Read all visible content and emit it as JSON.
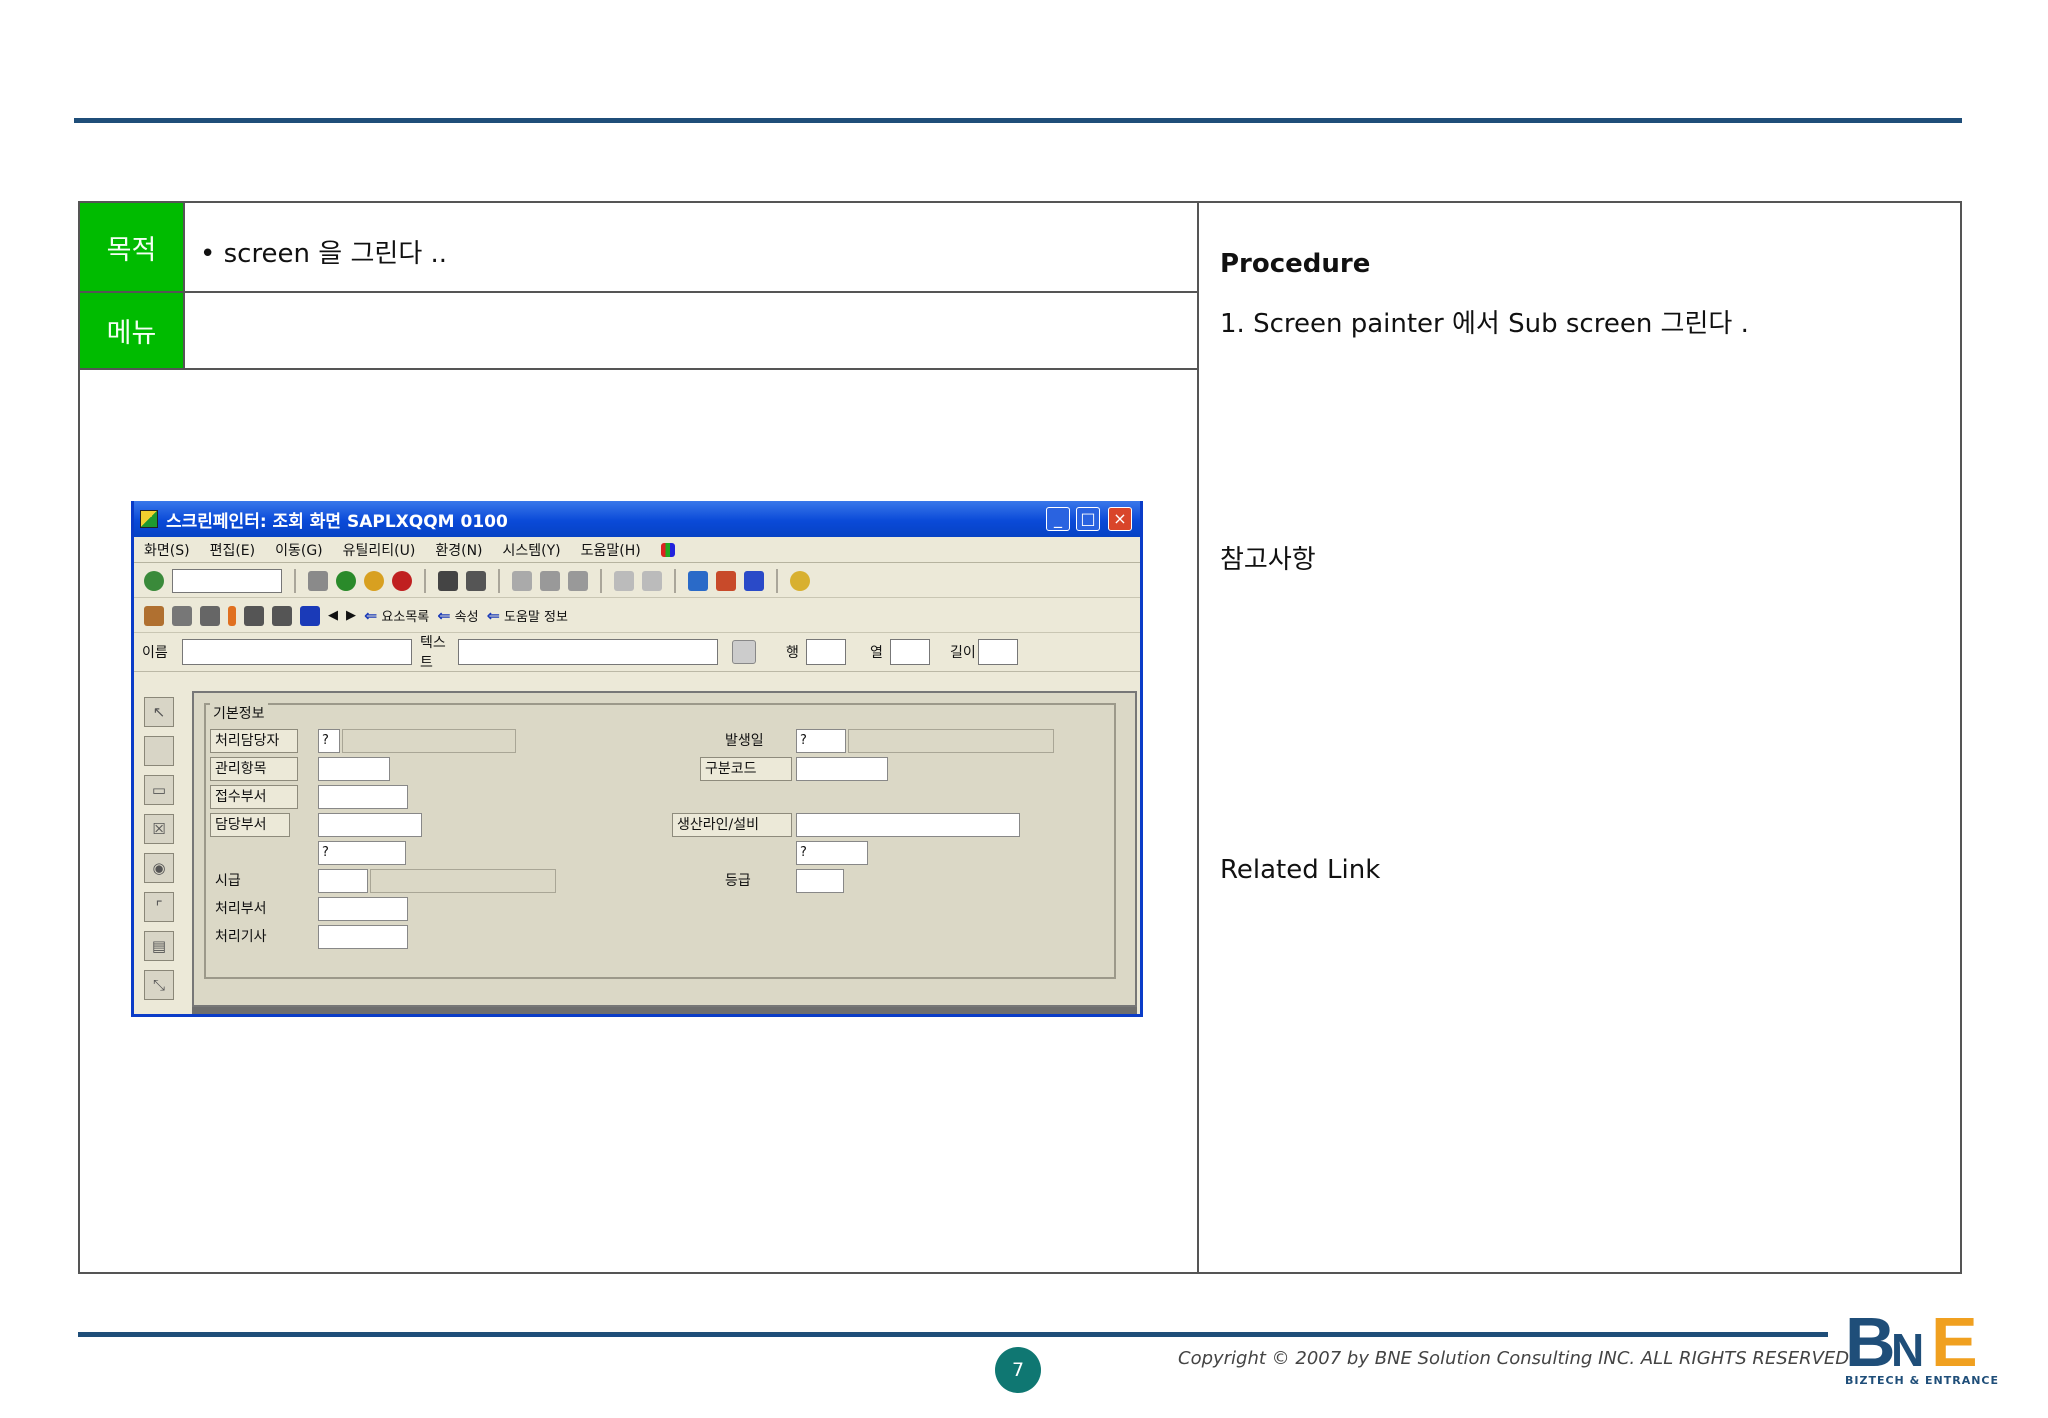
{
  "purpose": {
    "label": "목적",
    "text": "• screen 을 그린다 .."
  },
  "menu": {
    "label": "메뉴",
    "text": ""
  },
  "right": {
    "procedure_title": "Procedure",
    "procedure_step": "1. Screen painter 에서  Sub screen  그린다 .",
    "notes_label": "참고사항",
    "related_link": "Related Link"
  },
  "sap": {
    "title": "스크린페인터: 조회 화면 SAPLXQQM 0100",
    "menus": [
      "화면(S)",
      "편집(E)",
      "이동(G)",
      "유틸리티(U)",
      "환경(N)",
      "시스템(Y)",
      "도움말(H)"
    ],
    "toolbar_texts": [
      "요소목록",
      "속성",
      "도움말 정보"
    ],
    "field_labels": {
      "header_name": "이름",
      "header_text": "텍스트",
      "row": "행",
      "col": "열",
      "len": "길이"
    },
    "frame_title": "기본정보",
    "fields": [
      {
        "label": "처리담당자",
        "value": "?"
      },
      {
        "label": "관리항목",
        "value": ""
      },
      {
        "label": "접수부서",
        "value": ""
      },
      {
        "label": "담당부서",
        "value": ""
      },
      {
        "label": "",
        "value": "?"
      },
      {
        "label": "시급",
        "value": ""
      },
      {
        "label": "처리부서",
        "value": ""
      },
      {
        "label": "처리기사",
        "value": ""
      }
    ],
    "right_fields": [
      {
        "label": "발생일",
        "value": "?"
      },
      {
        "label": "구분코드",
        "value": ""
      },
      {
        "label": "생산라인/설비",
        "value": ""
      },
      {
        "label": "",
        "value": "?"
      },
      {
        "label": "등급",
        "value": ""
      }
    ]
  },
  "footer": {
    "page": "7",
    "copyright": "Copyright © 2007 by BNE Solution Consulting INC.   ALL RIGHTS RESERVED.",
    "logo_sub": "BIZTECH & ENTRANCE"
  },
  "colors": {
    "accent_rule": "#1f4e79",
    "label_green": "#00bb00",
    "page_badge": "#0f7772"
  }
}
